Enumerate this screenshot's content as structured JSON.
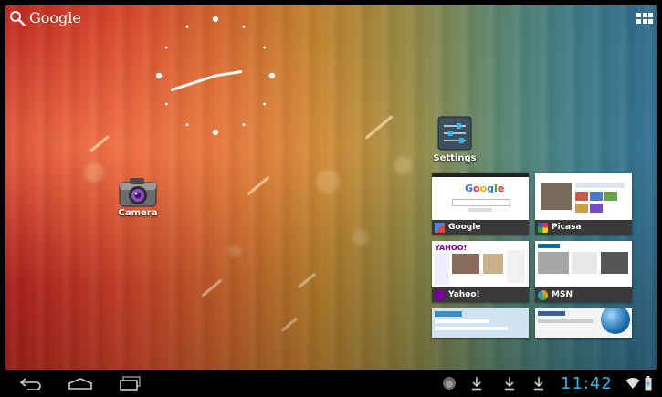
{
  "search": {
    "label": "Google"
  },
  "clock": {
    "hour": 2,
    "minute": 42
  },
  "shortcuts": {
    "camera": {
      "label": "Camera"
    },
    "settings": {
      "label": "Settings"
    }
  },
  "bookmarks": [
    {
      "label": "Google"
    },
    {
      "label": "Picasa"
    },
    {
      "label": "Yahoo!"
    },
    {
      "label": "MSN"
    },
    {
      "label": ""
    },
    {
      "label": ""
    }
  ],
  "status_bar": {
    "time": "11:42",
    "accent_color": "#33b5e5"
  }
}
